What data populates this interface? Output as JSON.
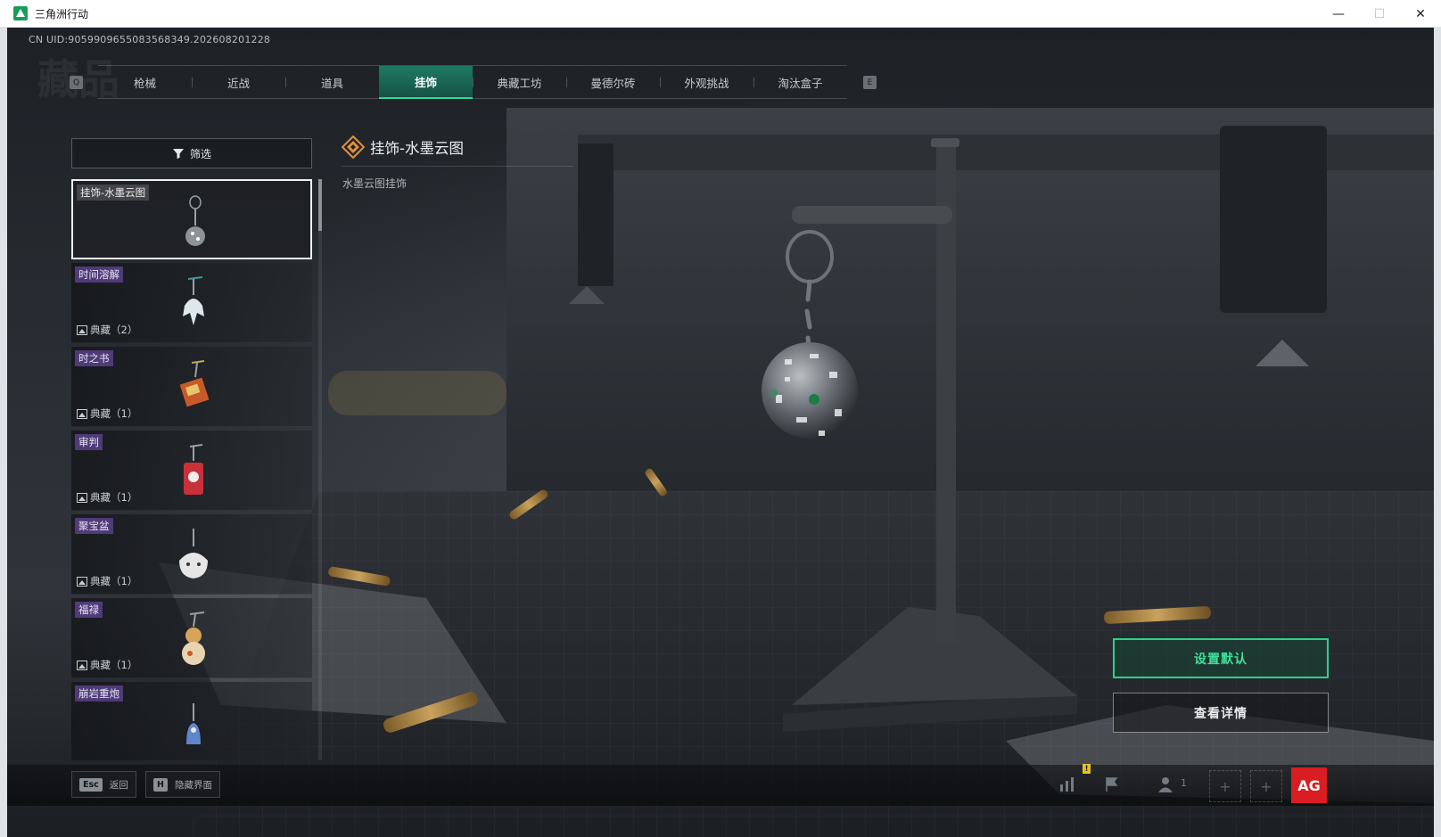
{
  "window": {
    "title": "三角洲行动",
    "controls": {
      "minimize": "—",
      "maximize": "☐",
      "close": "✕"
    }
  },
  "game": {
    "uid": "CN UID:9059909655083568349.202608201228",
    "watermark": "藏品",
    "tabs": {
      "left_key": "Q",
      "right_key": "E",
      "items": [
        {
          "label": "枪械",
          "active": false
        },
        {
          "label": "近战",
          "active": false
        },
        {
          "label": "道具",
          "active": false
        },
        {
          "label": "挂饰",
          "active": true
        },
        {
          "label": "典藏工坊",
          "active": false
        },
        {
          "label": "曼德尔砖",
          "active": false
        },
        {
          "label": "外观挑战",
          "active": false
        },
        {
          "label": "淘汰盒子",
          "active": false
        }
      ]
    },
    "filter": {
      "label": "筛选",
      "icon": "filter-icon"
    },
    "list": [
      {
        "name": "挂饰-水墨云图",
        "collect": "",
        "selected": true,
        "color": "#cfd3d6"
      },
      {
        "name": "时间溶解",
        "collect": "典藏（2）",
        "selected": false,
        "color": "#dfe6ec"
      },
      {
        "name": "时之书",
        "collect": "典藏（1）",
        "selected": false,
        "color": "#c85a2a"
      },
      {
        "name": "审判",
        "collect": "典藏（1）",
        "selected": false,
        "color": "#c8303a"
      },
      {
        "name": "聚宝盆",
        "collect": "典藏（1）",
        "selected": false,
        "color": "#e6e6e6"
      },
      {
        "name": "福禄",
        "collect": "典藏（1）",
        "selected": false,
        "color": "#d9a35a"
      },
      {
        "name": "崩岩重炮",
        "collect": "",
        "selected": false,
        "color": "#5f86c8"
      }
    ],
    "detail": {
      "title": "挂饰-水墨云图",
      "description": "水墨云图挂饰",
      "accent": "#e0933a"
    },
    "actions": {
      "set_default": "设置默认",
      "view_details": "查看详情",
      "accent": "#2fcf86"
    },
    "bottom": {
      "back": {
        "key": "Esc",
        "label": "返回"
      },
      "hide_ui": {
        "key": "H",
        "label": "隐藏界面"
      },
      "warn": "!",
      "team_count": "1",
      "add_slot": "+",
      "logo": "AG"
    }
  }
}
